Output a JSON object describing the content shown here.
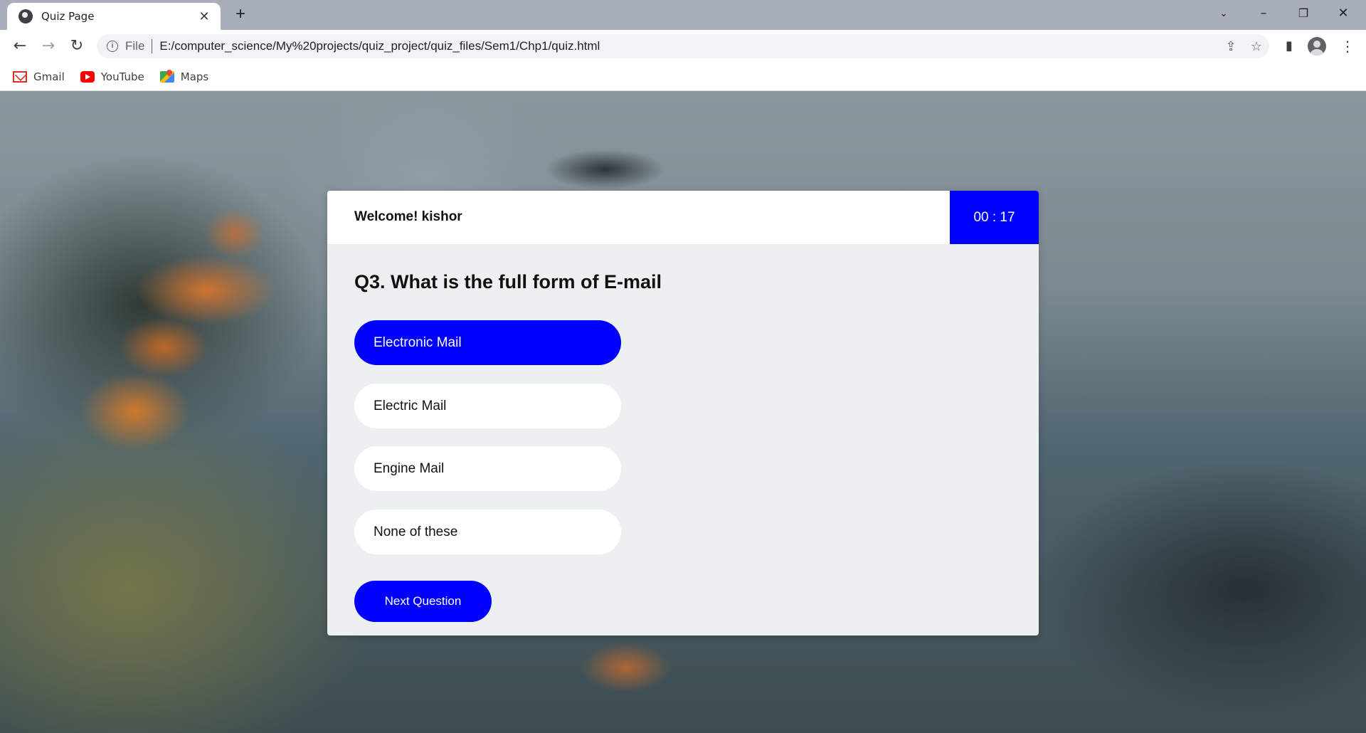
{
  "browser": {
    "tab_title": "Quiz Page",
    "address_scheme": "File",
    "address_url": "E:/computer_science/My%20projects/quiz_project/quiz_files/Sem1/Chp1/quiz.html",
    "bookmarks": [
      "Gmail",
      "YouTube",
      "Maps"
    ]
  },
  "icons": {
    "tab_favicon": "globe-icon",
    "tab_close": "close-icon",
    "new_tab": "plus-icon",
    "back": "arrow-left-icon",
    "forward": "arrow-right-icon",
    "reload": "reload-icon",
    "site_info": "info-icon",
    "share": "share-icon",
    "bookmark_star": "star-icon",
    "side_panel": "side-panel-icon",
    "profile": "avatar-icon",
    "menu": "kebab-menu-icon",
    "tab_search": "chevron-down-icon",
    "minimize": "minimize-icon",
    "maximize": "restore-icon",
    "close_window": "close-icon"
  },
  "quiz": {
    "welcome": "Welcome! kishor",
    "timer": "00 : 17",
    "question": "Q3. What is the full form of E-mail",
    "options": [
      "Electronic Mail",
      "Electric Mail",
      "Engine Mail",
      "None of these"
    ],
    "selected_index": 0,
    "next_label": "Next Question"
  },
  "colors": {
    "accent": "#0000ff",
    "card_body": "#ecf0f1",
    "header_bg": "#ffffff"
  }
}
